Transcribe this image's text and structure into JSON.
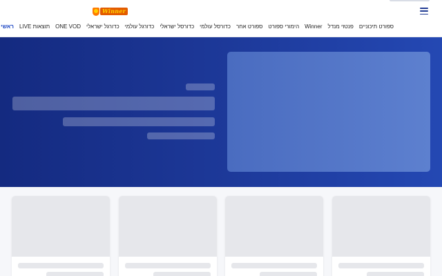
{
  "header": {
    "logo_text": "Winner",
    "menu_icon": "hamburger-menu-icon",
    "nav": [
      {
        "label": "ראשי",
        "active": true
      },
      {
        "label": "תוצאות LIVE",
        "active": false
      },
      {
        "label": "ONE VOD",
        "active": false
      },
      {
        "label": "כדורגל ישראלי",
        "active": false
      },
      {
        "label": "כדורגל עולמי",
        "active": false
      },
      {
        "label": "כדורסל ישראלי",
        "active": false
      },
      {
        "label": "כדורסל עולמי",
        "active": false
      },
      {
        "label": "ספורט אחר",
        "active": false
      },
      {
        "label": "הימורי ספורט",
        "active": false
      },
      {
        "label": "Winner",
        "active": false
      },
      {
        "label": "פנטזי מנדל",
        "active": false
      },
      {
        "label": "ספורט תיכוניים",
        "active": false
      }
    ]
  },
  "colors": {
    "accent": "#1f49c4",
    "hero_start": "#142a80",
    "hero_end": "#2448b3",
    "skeleton": "#e6e7eb"
  }
}
